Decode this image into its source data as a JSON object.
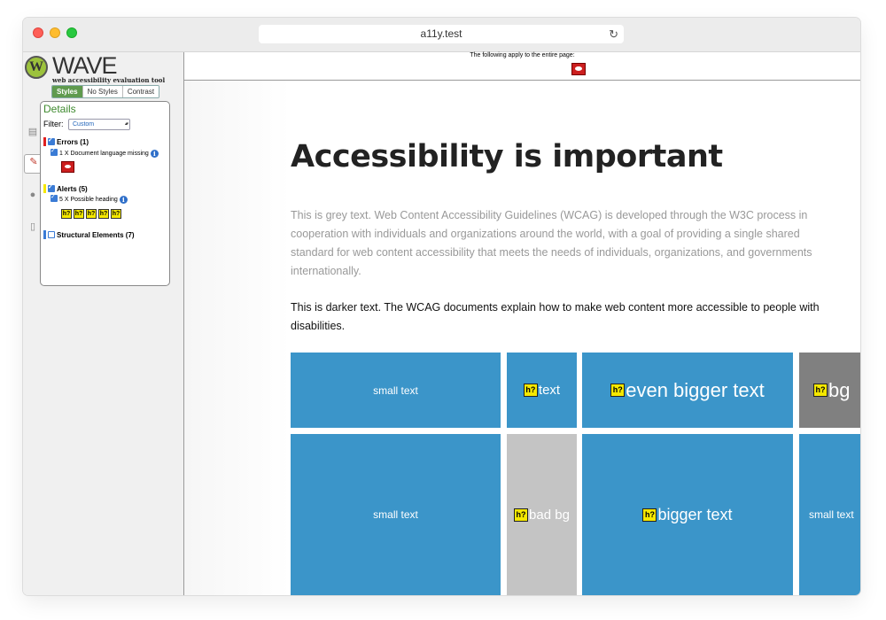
{
  "browser": {
    "url": "a11y.test"
  },
  "wave": {
    "title": "WAVE",
    "subtitle": "web accessibility evaluation tool",
    "view_buttons": [
      "Styles",
      "No Styles",
      "Contrast"
    ],
    "details_title": "Details",
    "filter_label": "Filter:",
    "filter_value": "Custom",
    "errors_label": "Errors (1)",
    "errors_item": "1 X Document language missing",
    "alerts_label": "Alerts (5)",
    "alerts_item": "5 X Possible heading",
    "alerts_icon_text": "h?",
    "structural_label": "Structural Elements (7)",
    "colors": {
      "errors": "#e02020",
      "alerts": "#f5e800",
      "structural": "#3a7bd5"
    }
  },
  "page": {
    "notice": "The following apply to the entire page:",
    "heading": "Accessibility is important",
    "grey_paragraph": "This is grey text. Web Content Accessibility Guidelines (WCAG) is developed through the W3C process in cooperation with individuals and organizations around the world, with a goal of providing a single shared standard for web content accessibility that meets the needs of individuals, organizations, and governments internationally.",
    "dark_paragraph": "This is darker text. The WCAG documents explain how to make web content more accessible to people with disabilities.",
    "tiles": {
      "r1c1": "small text",
      "r1c2": "text",
      "r1c3": "even bigger text",
      "r1c4": "bg",
      "r2c1": "small text",
      "r2c2": "bad bg",
      "r2c3": "bigger text",
      "r2c4": "small text",
      "hq": "h?"
    }
  }
}
